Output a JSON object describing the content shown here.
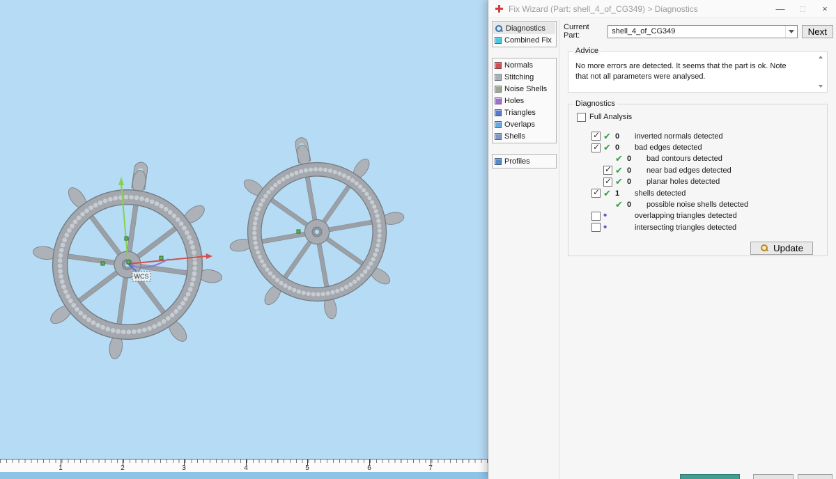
{
  "colors": {
    "viewport_bg": "#b6dbf4",
    "status_check_green": "#2f9e44",
    "marker_dot_blue": "#5a5ad2",
    "axis_green": "#86d24a",
    "axis_red": "#d4504a",
    "axis_purple": "#8a7ad0",
    "titlebar_cross_red": "#d23b3b"
  },
  "window": {
    "title": "Fix Wizard (Part: shell_4_of_CG349) > Diagnostics",
    "minimize": "—",
    "maximize": "□",
    "close": "×"
  },
  "sidebar": {
    "items": [
      {
        "label": "Diagnostics"
      },
      {
        "label": "Combined Fix"
      },
      {
        "label": "Normals"
      },
      {
        "label": "Stitching"
      },
      {
        "label": "Noise Shells"
      },
      {
        "label": "Holes"
      },
      {
        "label": "Triangles"
      },
      {
        "label": "Overlaps"
      },
      {
        "label": "Shells"
      },
      {
        "label": "Profiles"
      }
    ]
  },
  "header": {
    "current_part_label": "Current Part:",
    "current_part_value": "shell_4_of_CG349",
    "next_button": "Next"
  },
  "advice": {
    "legend": "Advice",
    "text": "No more errors are detected. It seems that the part is ok. Note that not all parameters were analysed."
  },
  "diagnostics": {
    "legend": "Diagnostics",
    "full_analysis": "Full Analysis",
    "rows": [
      {
        "count": "0",
        "label": "inverted normals detected"
      },
      {
        "count": "0",
        "label": "bad edges detected"
      },
      {
        "count": "0",
        "label": "bad contours detected"
      },
      {
        "count": "0",
        "label": "near bad edges detected"
      },
      {
        "count": "0",
        "label": "planar holes detected"
      },
      {
        "count": "1",
        "label": "shells detected"
      },
      {
        "count": "0",
        "label": "possible noise shells detected"
      },
      {
        "count": "",
        "label": "overlapping triangles detected"
      },
      {
        "count": "",
        "label": "intersecting triangles detected"
      }
    ],
    "update_button": "Update"
  },
  "viewport": {
    "wcs_label": "WCS",
    "ruler_labels": [
      "1",
      "2",
      "3",
      "4",
      "5",
      "6",
      "7"
    ]
  }
}
